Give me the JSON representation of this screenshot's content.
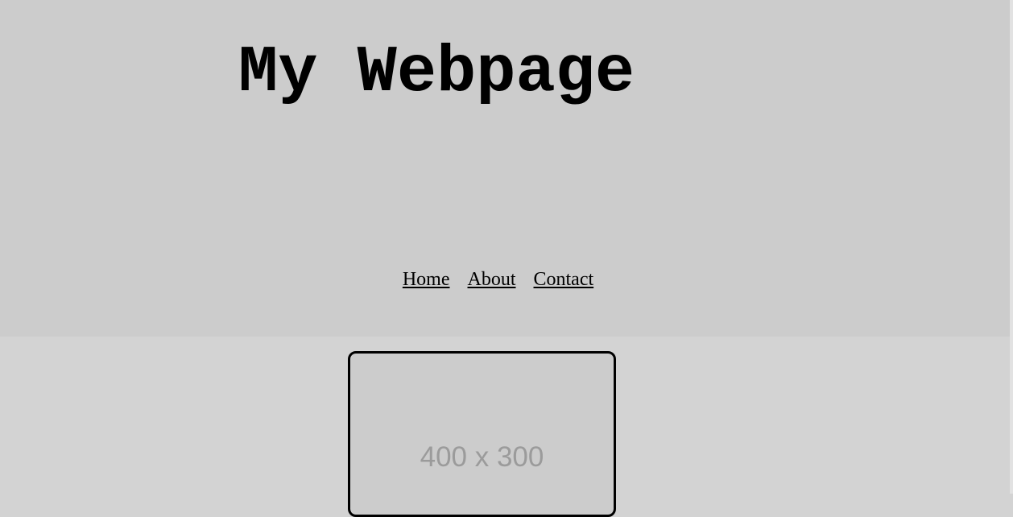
{
  "header": {
    "title": "My Webpage"
  },
  "nav": {
    "items": [
      {
        "label": "Home"
      },
      {
        "label": "About"
      },
      {
        "label": "Contact"
      }
    ]
  },
  "main": {
    "image_placeholder": "400 x 300"
  },
  "colors": {
    "header_bg": "#cccccc",
    "page_bg": "#d3d3d3",
    "placeholder_text": "#9b9b9b"
  }
}
